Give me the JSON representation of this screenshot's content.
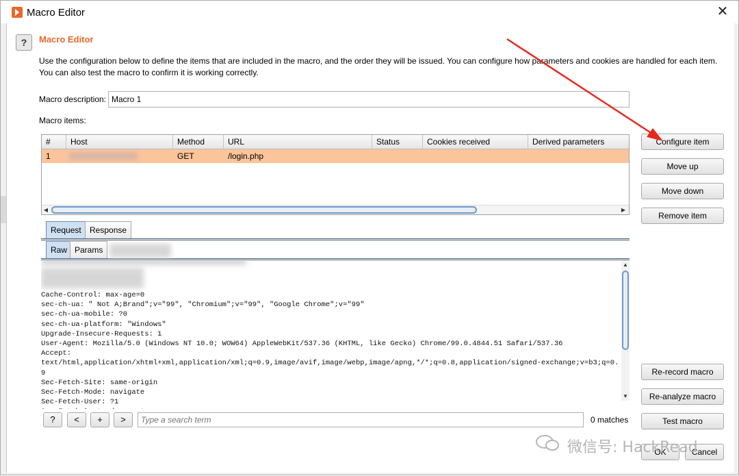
{
  "window": {
    "title": "Macro Editor",
    "close_glyph": "✕"
  },
  "header": {
    "help_glyph": "?",
    "heading": "Macro Editor",
    "intro": "Use the configuration below to define the items that are included in the macro, and the order they will be issued. You can configure how parameters and cookies are handled for each item. You can also test the macro to confirm it is working correctly."
  },
  "description": {
    "label": "Macro description:",
    "value": "Macro 1"
  },
  "items": {
    "label": "Macro items:",
    "columns": [
      "#",
      "Host",
      "Method",
      "URL",
      "Status",
      "Cookies received",
      "Derived parameters"
    ],
    "rows": [
      {
        "num": "1",
        "host": "",
        "method": "GET",
        "url": "/login.php",
        "status": "",
        "cookies": "",
        "derived": ""
      }
    ]
  },
  "side_buttons": {
    "configure": "Configure item",
    "move_up": "Move up",
    "move_down": "Move down",
    "remove": "Remove item",
    "rerecord": "Re-record macro",
    "reanalyze": "Re-analyze macro",
    "test": "Test macro"
  },
  "tabs_outer": [
    "Request",
    "Response"
  ],
  "tabs_inner": [
    "Raw",
    "Params"
  ],
  "request_lines": [
    "Cache-Control: max-age=0",
    "sec-ch-ua: \" Not A;Brand\";v=\"99\", \"Chromium\";v=\"99\", \"Google Chrome\";v=\"99\"",
    "sec-ch-ua-mobile: ?0",
    "sec-ch-ua-platform: \"Windows\"",
    "Upgrade-Insecure-Requests: 1",
    "User-Agent: Mozilla/5.0 (Windows NT 10.0; WOW64) AppleWebKit/537.36 (KHTML, like Gecko) Chrome/99.0.4844.51 Safari/537.36",
    "Accept:",
    "text/html,application/xhtml+xml,application/xml;q=0.9,image/avif,image/webp,image/apng,*/*;q=0.8,application/signed-exchange;v=b3;q=0.",
    "9",
    "Sec-Fetch-Site: same-origin",
    "Sec-Fetch-Mode: navigate",
    "Sec-Fetch-User: ?1",
    "Sec-Fetch-Dest: document"
  ],
  "search_bar": {
    "help": "?",
    "prev": "<",
    "add": "+",
    "next": ">",
    "placeholder": "Type a search term",
    "matches": "0 matches"
  },
  "dialog_buttons": {
    "ok": "OK",
    "cancel": "Cancel"
  },
  "watermark": "微信号: HackRead",
  "colors": {
    "accent": "#e8682a",
    "selected_row": "#fbc49a",
    "annotation_arrow": "#e8281e"
  }
}
